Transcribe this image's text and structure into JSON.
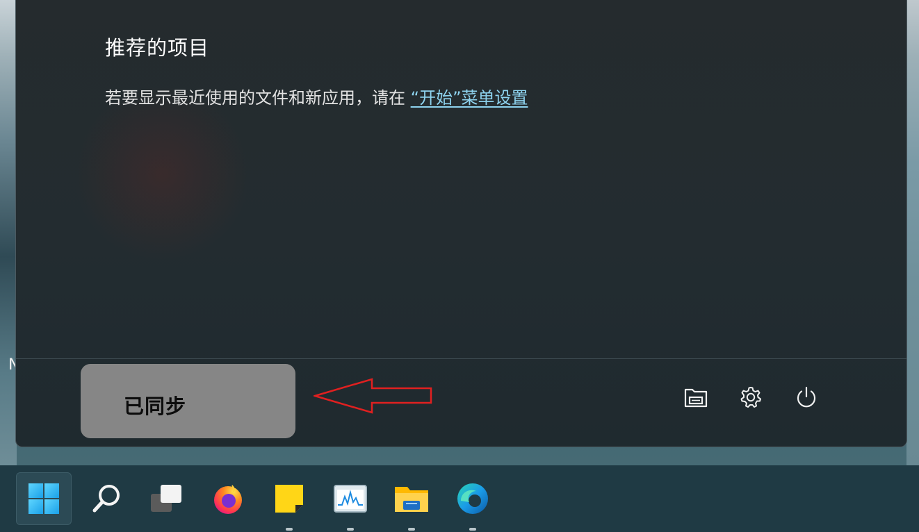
{
  "start_menu": {
    "recommended": {
      "title": "推荐的项目",
      "description": "若要显示最近使用的文件和新应用，请在 ",
      "settings_link": "“开始”菜单设置"
    },
    "account": {
      "status_label": "已同步"
    },
    "footer_icons": [
      "documents-folder-icon",
      "settings-gear-icon",
      "power-icon"
    ]
  },
  "wallpaper": {
    "partial_text": "N"
  },
  "taskbar": {
    "items": [
      {
        "name": "start-button",
        "icon": "windows-logo-icon"
      },
      {
        "name": "search-button",
        "icon": "search-icon"
      },
      {
        "name": "task-view-button",
        "icon": "task-view-icon"
      },
      {
        "name": "firefox-app",
        "icon": "firefox-icon"
      },
      {
        "name": "sticky-notes-app",
        "icon": "sticky-notes-icon"
      },
      {
        "name": "task-manager-app",
        "icon": "task-manager-icon"
      },
      {
        "name": "file-explorer-app",
        "icon": "folder-icon"
      },
      {
        "name": "edge-app",
        "icon": "edge-icon"
      }
    ]
  },
  "colors": {
    "link": "#8ed3ef",
    "annotation_arrow": "#e02020",
    "account_badge": "#868686"
  }
}
